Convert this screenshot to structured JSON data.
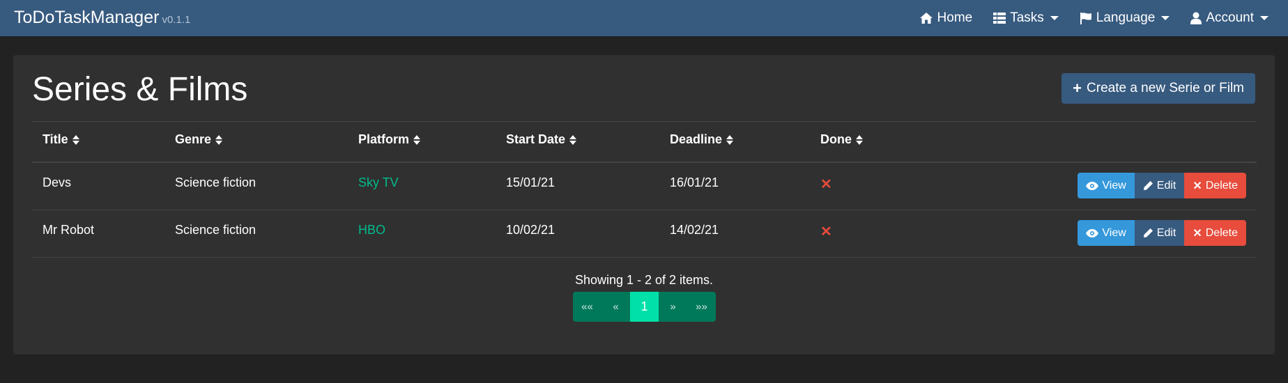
{
  "navbar": {
    "brand": "ToDoTaskManager",
    "version": "v0.1.1",
    "items": [
      {
        "label": "Home",
        "icon": "home-icon",
        "dropdown": false
      },
      {
        "label": "Tasks",
        "icon": "table-icon",
        "dropdown": true
      },
      {
        "label": "Language",
        "icon": "flag-icon",
        "dropdown": true
      },
      {
        "label": "Account",
        "icon": "user-icon",
        "dropdown": true
      }
    ]
  },
  "page": {
    "title": "Series & Films",
    "create_label": "Create a new Serie or Film"
  },
  "table": {
    "columns": [
      "Title",
      "Genre",
      "Platform",
      "Start Date",
      "Deadline",
      "Done"
    ],
    "rows": [
      {
        "title": "Devs",
        "genre": "Science fiction",
        "platform": "Sky TV",
        "start": "15/01/21",
        "deadline": "16/01/21",
        "done": false
      },
      {
        "title": "Mr Robot",
        "genre": "Science fiction",
        "platform": "HBO",
        "start": "10/02/21",
        "deadline": "14/02/21",
        "done": false
      }
    ],
    "actions": {
      "view": "View",
      "edit": "Edit",
      "delete": "Delete"
    }
  },
  "pagination": {
    "summary": "Showing 1 - 2 of 2 items.",
    "first": "««",
    "prev": "«",
    "current": "1",
    "next": "»",
    "last": "»»"
  },
  "colors": {
    "navbar": "#375a7f",
    "background": "#222222",
    "card": "#303030",
    "link": "#00bc8c",
    "view": "#3498db",
    "edit": "#375a7f",
    "delete": "#e74c3c"
  }
}
